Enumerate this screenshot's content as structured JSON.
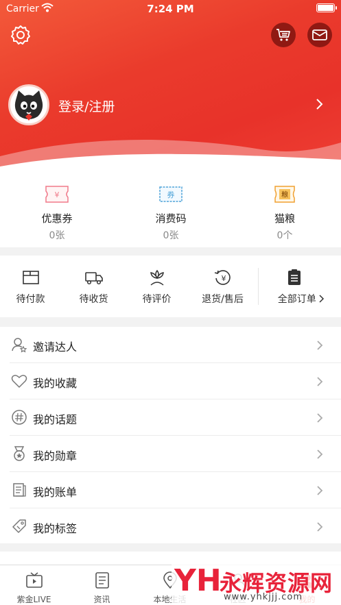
{
  "status_bar": {
    "carrier": "Carrier",
    "time": "7:24 PM"
  },
  "header": {
    "login_label": "登录/注册"
  },
  "wallet": [
    {
      "label": "优惠券",
      "value": "0张",
      "icon": "coupon-icon",
      "icon_text": "¥",
      "color": "#f07a8a"
    },
    {
      "label": "消费码",
      "value": "0张",
      "icon": "voucher-icon",
      "icon_text": "券",
      "color": "#4ea3d8"
    },
    {
      "label": "猫粮",
      "value": "0个",
      "icon": "cat-food-icon",
      "icon_text": "粮",
      "color": "#f0a030"
    }
  ],
  "orders": [
    {
      "label": "待付款",
      "icon": "wallet-icon"
    },
    {
      "label": "待收货",
      "icon": "truck-icon"
    },
    {
      "label": "待评价",
      "icon": "flower-icon"
    },
    {
      "label": "退货/售后",
      "icon": "refund-icon"
    },
    {
      "label": "全部订单",
      "icon": "clipboard-icon"
    }
  ],
  "menu": [
    {
      "label": "邀请达人",
      "icon": "invite-user-icon"
    },
    {
      "label": "我的收藏",
      "icon": "heart-icon"
    },
    {
      "label": "我的话题",
      "icon": "hashtag-icon"
    },
    {
      "label": "我的勋章",
      "icon": "medal-icon"
    },
    {
      "label": "我的账单",
      "icon": "bill-icon"
    },
    {
      "label": "我的标签",
      "icon": "tag-icon"
    }
  ],
  "tabs": [
    {
      "label": "紫金LIVE",
      "icon": "tv-icon",
      "active": false
    },
    {
      "label": "资讯",
      "icon": "news-icon",
      "active": false
    },
    {
      "label": "本地生活",
      "icon": "location-icon",
      "active": false
    },
    {
      "label": "社区",
      "icon": "community-icon",
      "active": false
    },
    {
      "label": "我的",
      "icon": "profile-icon",
      "active": true
    }
  ],
  "watermark": {
    "logo": "YH",
    "title": "永辉资源网",
    "url": "www.yhkjjj.com"
  },
  "colors": {
    "accent": "#e8352b",
    "header_red": "#ea3b2c"
  }
}
